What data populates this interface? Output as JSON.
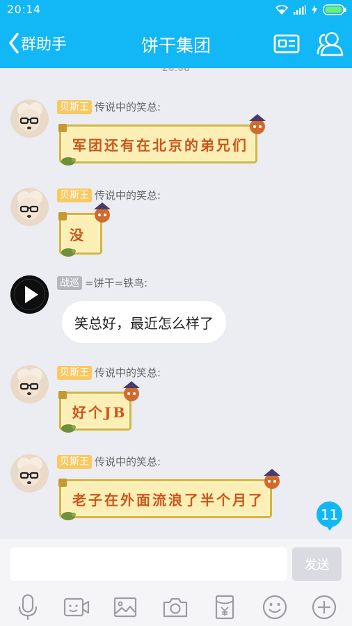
{
  "status_bar": {
    "time": "20:14"
  },
  "nav": {
    "back_label": "群助手",
    "title": "饼干集团"
  },
  "chat": {
    "time_divider": "20:08",
    "messages": [
      {
        "badge": "贝斯王",
        "sender": "传说中的笑总:",
        "text": "军团还有在北京的弟兄们",
        "style": "sticker-yellow"
      },
      {
        "badge": "贝斯王",
        "sender": "传说中的笑总:",
        "text": "没",
        "style": "sticker-yellow"
      },
      {
        "badge": "战巡",
        "sender": "=饼干=铁鸟:",
        "text": "笑总好，最近怎么样了",
        "style": "plain"
      },
      {
        "badge": "贝斯王",
        "sender": "传说中的笑总:",
        "text": "好个JB",
        "style": "sticker-yellow"
      },
      {
        "badge": "贝斯王",
        "sender": "传说中的笑总:",
        "text": "老子在外面流浪了半个月了",
        "style": "sticker-yellow"
      }
    ],
    "unread_count": "11"
  },
  "input": {
    "value": "",
    "placeholder": "",
    "send_label": "发送"
  },
  "colors": {
    "accent": "#12b7f5",
    "badge_gold": "#f9c960",
    "badge_gray": "#b5b7bd",
    "chat_bg": "#ebedf3"
  }
}
